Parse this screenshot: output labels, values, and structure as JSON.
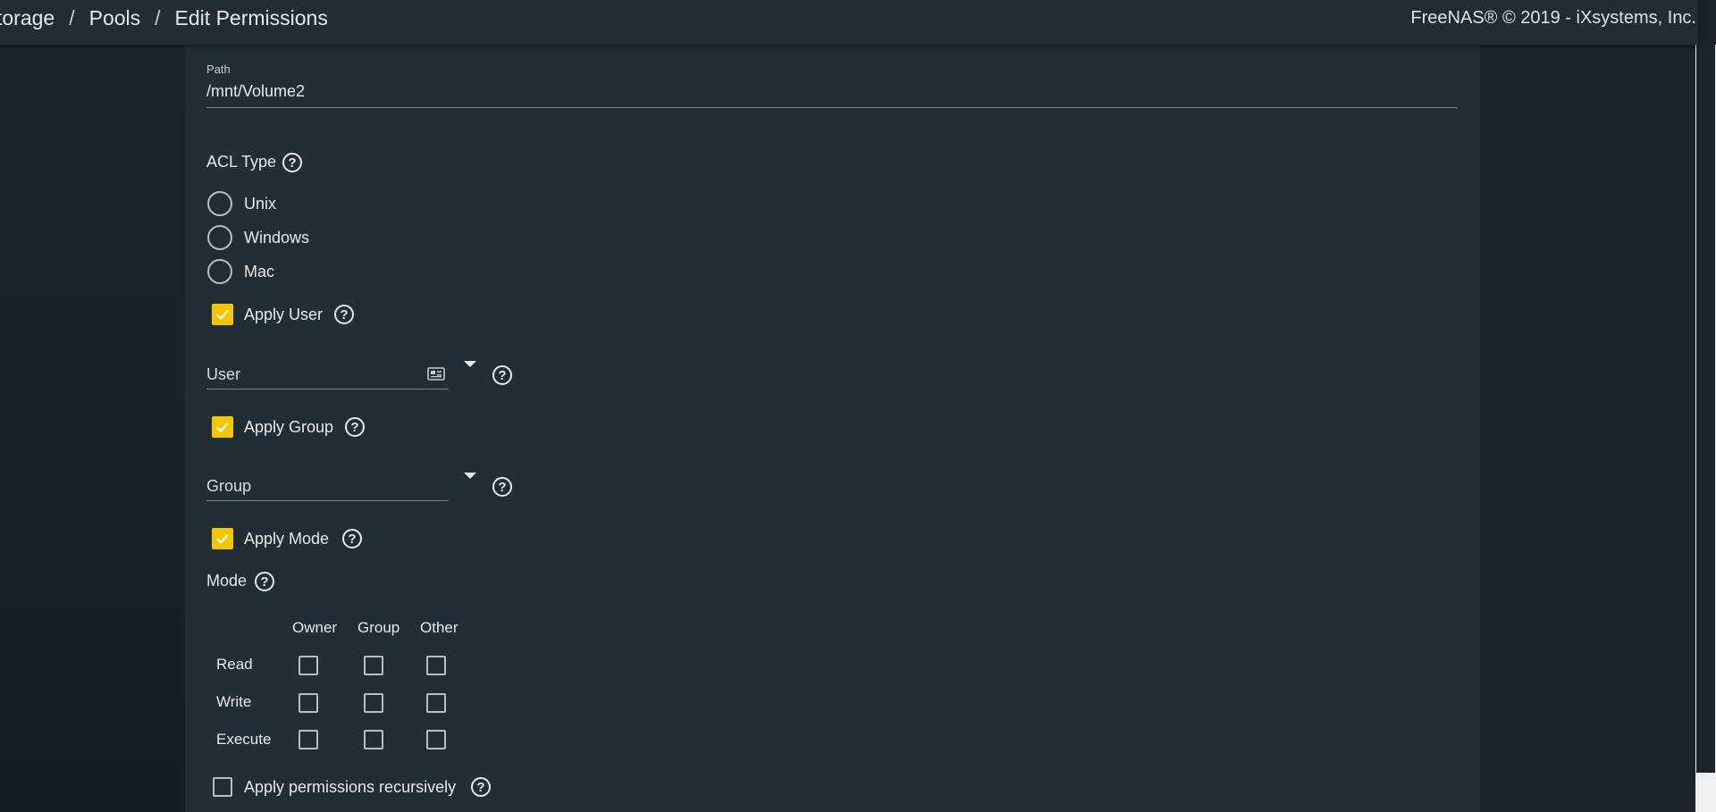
{
  "header": {
    "breadcrumb": [
      "torage",
      "Pools",
      "Edit Permissions"
    ],
    "separator": "/",
    "copyright": "FreeNAS® © 2019 - iXsystems, Inc."
  },
  "form": {
    "path": {
      "label": "Path",
      "value": "/mnt/Volume2"
    },
    "acl_type": {
      "label": "ACL Type",
      "options": [
        "Unix",
        "Windows",
        "Mac"
      ],
      "selected": null
    },
    "apply_user": {
      "label": "Apply User",
      "checked": true
    },
    "user": {
      "placeholder": "User",
      "value": ""
    },
    "apply_group": {
      "label": "Apply Group",
      "checked": true
    },
    "group": {
      "placeholder": "Group",
      "value": ""
    },
    "apply_mode": {
      "label": "Apply Mode",
      "checked": true
    },
    "mode": {
      "label": "Mode",
      "columns": [
        "Owner",
        "Group",
        "Other"
      ],
      "rows": [
        "Read",
        "Write",
        "Execute"
      ],
      "values": [
        [
          false,
          false,
          false
        ],
        [
          false,
          false,
          false
        ],
        [
          false,
          false,
          false
        ]
      ]
    },
    "recursive": {
      "label": "Apply permissions recursively",
      "checked": false
    }
  },
  "colors": {
    "accent": "#f3c600",
    "card": "#232d36",
    "topbar": "#222c35"
  }
}
